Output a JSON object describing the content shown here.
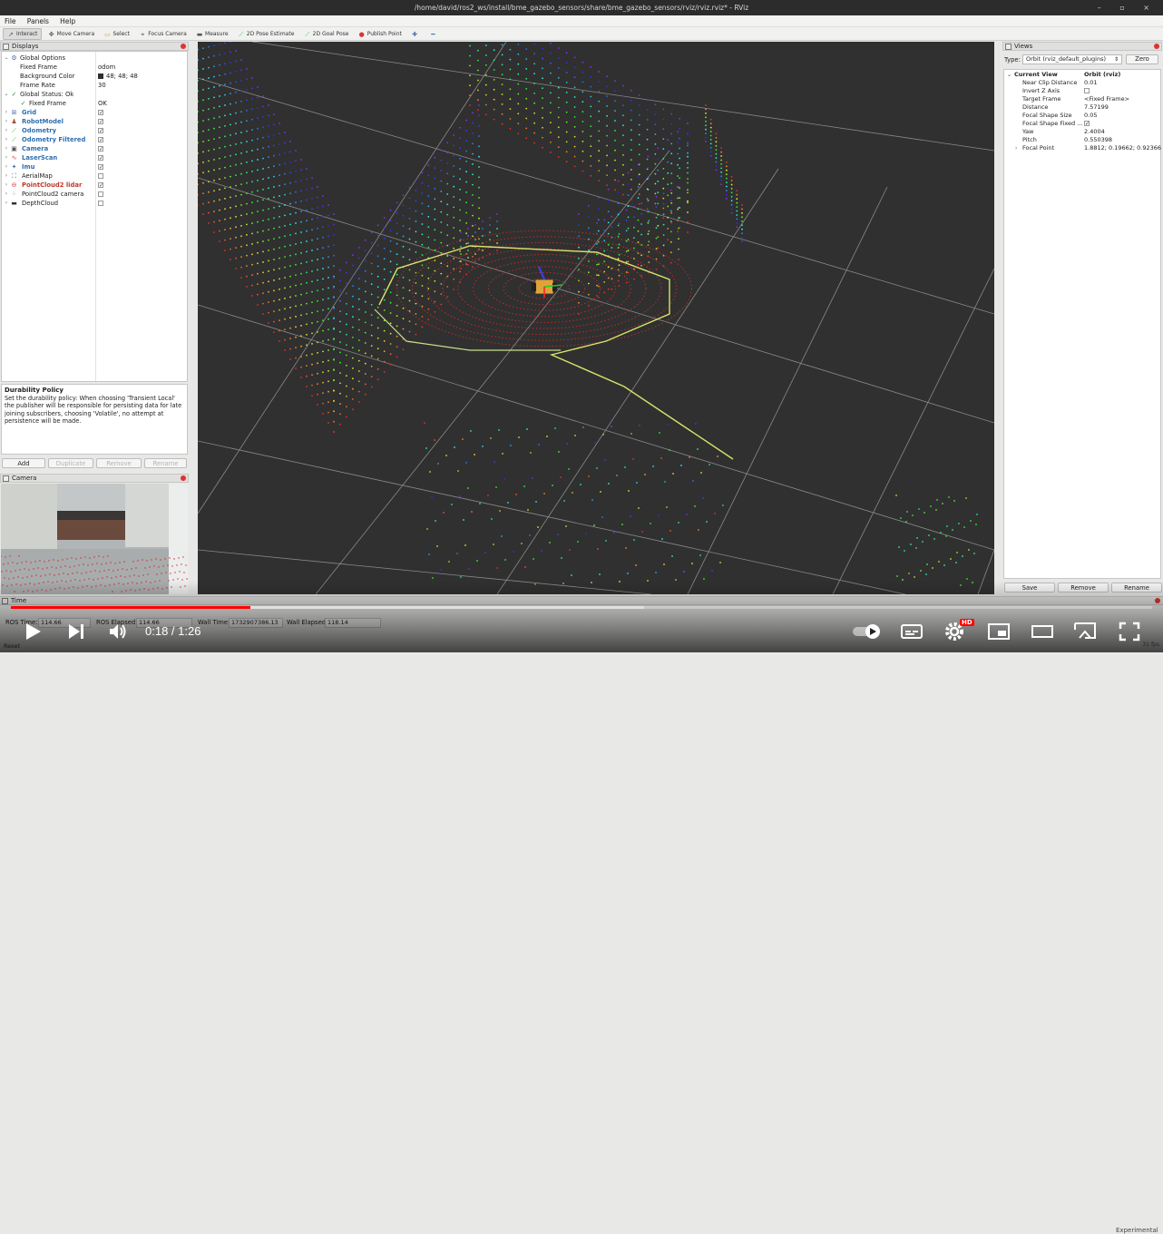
{
  "window": {
    "title": "/home/david/ros2_ws/install/bme_gazebo_sensors/share/bme_gazebo_sensors/rviz/rviz.rviz* - RViz",
    "controls": "– ▫ ×"
  },
  "menu": {
    "file": "File",
    "panels": "Panels",
    "help": "Help"
  },
  "toolbar": {
    "tools": [
      {
        "label": "Interact",
        "icon": "cursor-icon"
      },
      {
        "label": "Move Camera",
        "icon": "move-camera-icon"
      },
      {
        "label": "Select",
        "icon": "select-icon"
      },
      {
        "label": "Focus Camera",
        "icon": "focus-camera-icon"
      },
      {
        "label": "Measure",
        "icon": "measure-icon"
      },
      {
        "label": "2D Pose Estimate",
        "icon": "pose-estimate-icon"
      },
      {
        "label": "2D Goal Pose",
        "icon": "goal-pose-icon"
      },
      {
        "label": "Publish Point",
        "icon": "publish-point-icon"
      }
    ]
  },
  "displays": {
    "title": "Displays",
    "rows": {
      "global_options": "Global Options",
      "fixed_frame_label": "Fixed Frame",
      "fixed_frame_value": "odom",
      "background_color_label": "Background Color",
      "background_color_value": "48; 48; 48",
      "frame_rate_label": "Frame Rate",
      "frame_rate_value": "30",
      "global_status": "Global Status: Ok",
      "status_fixed_frame": "Fixed Frame",
      "status_fixed_frame_value": "OK",
      "grid": "Grid",
      "robot_model": "RobotModel",
      "odometry": "Odometry",
      "odometry_filtered": "Odometry Filtered",
      "camera": "Camera",
      "laser_scan": "LaserScan",
      "imu": "Imu",
      "aerial_map": "AerialMap",
      "pointcloud2_lidar": "PointCloud2 lidar",
      "pointcloud2_camera": "PointCloud2 camera",
      "depth_cloud": "DepthCloud"
    },
    "enabled": {
      "grid": true,
      "robot_model": true,
      "odometry": true,
      "odometry_filtered": true,
      "camera": true,
      "laser_scan": true,
      "imu": true,
      "aerial_map": false,
      "pointcloud2_lidar": true,
      "pointcloud2_camera": false,
      "depth_cloud": false
    },
    "description": {
      "title": "Durability Policy",
      "text": "Set the durability policy: When choosing 'Transient Local' the publisher will be responsible for persisting data for late joining subscribers, choosing 'Volatile', no attempt at persistence will be made."
    },
    "buttons": {
      "add": "Add",
      "duplicate": "Duplicate",
      "remove": "Remove",
      "rename": "Rename"
    }
  },
  "camera_panel": {
    "title": "Camera"
  },
  "views": {
    "title": "Views",
    "type_label": "Type:",
    "type_value": "Orbit (rviz_default_plugins)",
    "zero": "Zero",
    "current_view_label": "Current View",
    "current_view_value": "Orbit (rviz)",
    "props": [
      {
        "label": "Near Clip Distance",
        "value": "0.01"
      },
      {
        "label": "Invert Z Axis",
        "value": ""
      },
      {
        "label": "Target Frame",
        "value": "<Fixed Frame>"
      },
      {
        "label": "Distance",
        "value": "7.57199"
      },
      {
        "label": "Focal Shape Size",
        "value": "0.05"
      },
      {
        "label": "Focal Shape Fixed ...",
        "value": ""
      },
      {
        "label": "Yaw",
        "value": "2.4004"
      },
      {
        "label": "Pitch",
        "value": "0.550398"
      },
      {
        "label": "Focal Point",
        "value": "1.8812; 0.19662; 0.92366"
      }
    ],
    "buttons": {
      "save": "Save",
      "remove": "Remove",
      "rename": "Rename"
    }
  },
  "time_panel": {
    "title": "Time",
    "ros_time_label": "ROS Time:",
    "ros_time_value": "114.66",
    "ros_elapsed_label": "ROS Elapsed:",
    "ros_elapsed_value": "114.66",
    "wall_time_label": "Wall Time:",
    "wall_time_value": "1732907386.13",
    "wall_elapsed_label": "Wall Elapsed:",
    "wall_elapsed_value": "118.14",
    "reset": "Reset",
    "experimental": "Experimental",
    "fps": "31 fps"
  },
  "player": {
    "current_time": "0:18",
    "duration": "1:26",
    "time_display": "0:18 / 1:26",
    "played_fraction": 0.21,
    "buffered_fraction": 0.555,
    "hd_badge": "HD"
  },
  "colors": {
    "accent": "#ff0000",
    "viewport_bg": "#303030",
    "lab_blue": "#2f6fb0",
    "lab_red": "#c0392b"
  }
}
